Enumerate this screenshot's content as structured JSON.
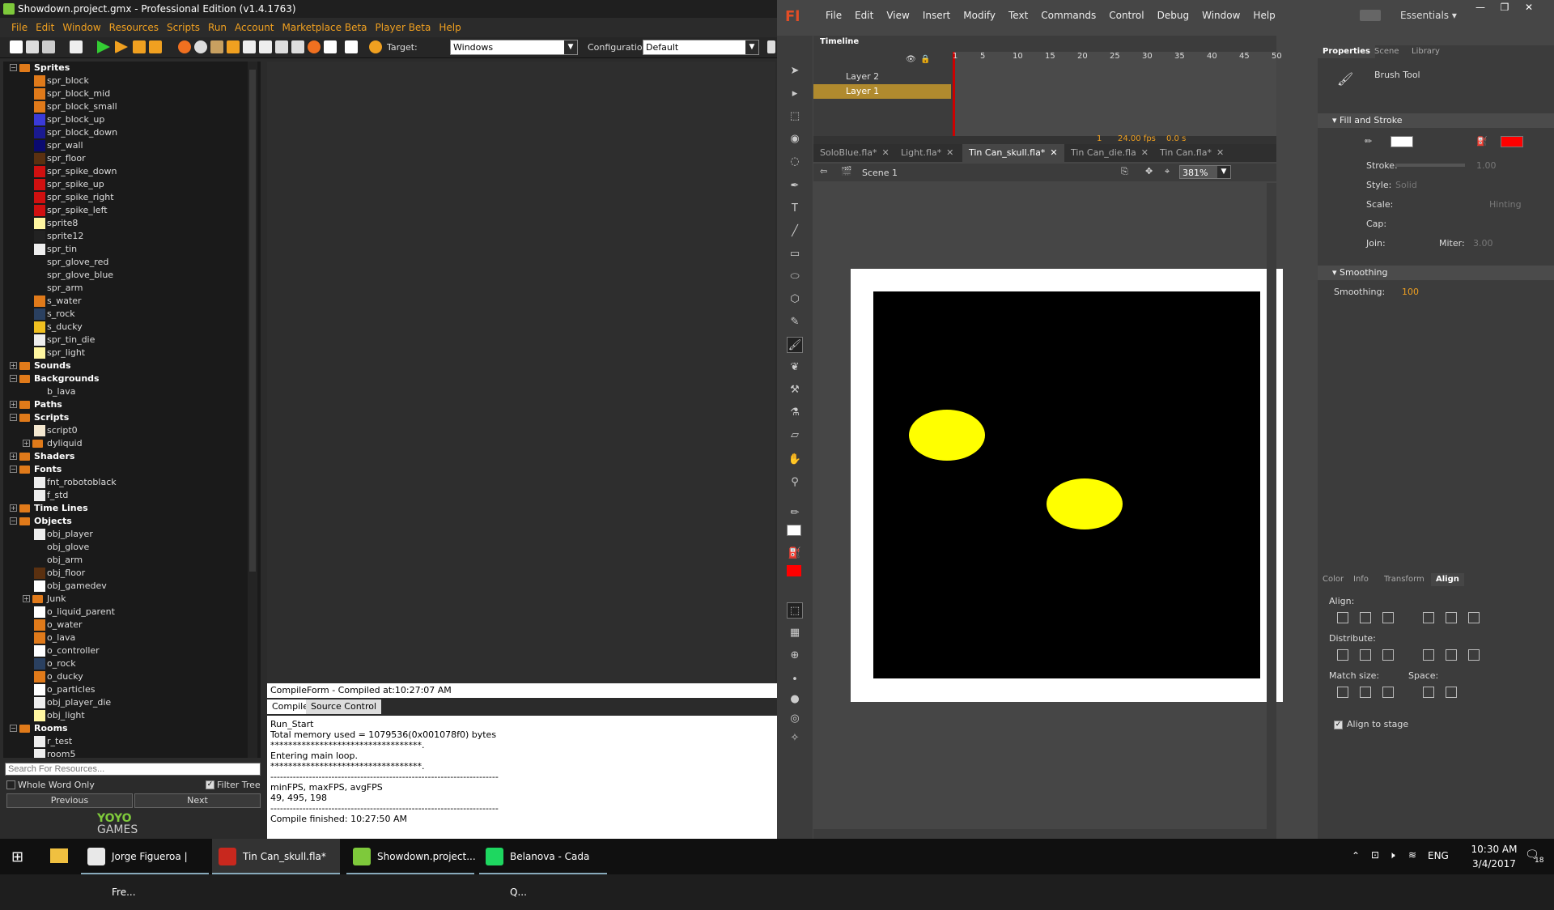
{
  "gm": {
    "title": "Showdown.project.gmx - Professional Edition (v1.4.1763)",
    "menu": [
      "File",
      "Edit",
      "Window",
      "Resources",
      "Scripts",
      "Run",
      "Account",
      "Marketplace Beta",
      "Player Beta",
      "Help"
    ],
    "target_label": "Target:",
    "target_value": "Windows",
    "config_label": "Configuration:",
    "config_value": "Default",
    "tree": [
      {
        "type": "folder",
        "label": "Sprites",
        "depth": 0,
        "expanded": true
      },
      {
        "type": "item",
        "label": "spr_block",
        "color": "#e07a1a"
      },
      {
        "type": "item",
        "label": "spr_block_mid",
        "color": "#e07a1a"
      },
      {
        "type": "item",
        "label": "spr_block_small",
        "color": "#e07a1a"
      },
      {
        "type": "item",
        "label": "spr_block_up",
        "color": "#3a3ad8"
      },
      {
        "type": "item",
        "label": "spr_block_down",
        "color": "#1a1a90"
      },
      {
        "type": "item",
        "label": "spr_wall",
        "color": "#0a0a70"
      },
      {
        "type": "item",
        "label": "spr_floor",
        "color": "#5a3010"
      },
      {
        "type": "item",
        "label": "spr_spike_down",
        "color": "#d01010"
      },
      {
        "type": "item",
        "label": "spr_spike_up",
        "color": "#d01010"
      },
      {
        "type": "item",
        "label": "spr_spike_right",
        "color": "#d01010"
      },
      {
        "type": "item",
        "label": "spr_spike_left",
        "color": "#d01010"
      },
      {
        "type": "item",
        "label": "sprite8",
        "color": "#fff6a0"
      },
      {
        "type": "item",
        "label": "sprite12",
        "color": "#222222"
      },
      {
        "type": "item",
        "label": "spr_tin",
        "color": "#eeeeee"
      },
      {
        "type": "item",
        "label": "spr_glove_red",
        "color": "#1a1a1a"
      },
      {
        "type": "item",
        "label": "spr_glove_blue",
        "color": "#1a1a1a"
      },
      {
        "type": "item",
        "label": "spr_arm",
        "color": "#1a1a1a"
      },
      {
        "type": "item",
        "label": "s_water",
        "color": "#e07a1a"
      },
      {
        "type": "item",
        "label": "s_rock",
        "color": "#2a4060"
      },
      {
        "type": "item",
        "label": "s_ducky",
        "color": "#f0c020"
      },
      {
        "type": "item",
        "label": "spr_tin_die",
        "color": "#eeeeee"
      },
      {
        "type": "item",
        "label": "spr_light",
        "color": "#fff6a0"
      },
      {
        "type": "folder",
        "label": "Sounds",
        "depth": 0,
        "expanded": false
      },
      {
        "type": "folder",
        "label": "Backgrounds",
        "depth": 0,
        "expanded": true
      },
      {
        "type": "item",
        "label": "b_lava",
        "color": ""
      },
      {
        "type": "folder",
        "label": "Paths",
        "depth": 0,
        "expanded": false
      },
      {
        "type": "folder",
        "label": "Scripts",
        "depth": 0,
        "expanded": true
      },
      {
        "type": "item",
        "label": "script0",
        "color": "#f4e8d0"
      },
      {
        "type": "subfolder",
        "label": "dyliquid",
        "color": ""
      },
      {
        "type": "folder",
        "label": "Shaders",
        "depth": 0,
        "expanded": false
      },
      {
        "type": "folder",
        "label": "Fonts",
        "depth": 0,
        "expanded": true
      },
      {
        "type": "item",
        "label": "fnt_robotoblack",
        "color": "#eeeeee"
      },
      {
        "type": "item",
        "label": "f_std",
        "color": "#eeeeee"
      },
      {
        "type": "folder",
        "label": "Time Lines",
        "depth": 0,
        "expanded": false
      },
      {
        "type": "folder",
        "label": "Objects",
        "depth": 0,
        "expanded": true
      },
      {
        "type": "item",
        "label": "obj_player",
        "color": "#eeeeee"
      },
      {
        "type": "item",
        "label": "obj_glove",
        "color": "#1a1a1a"
      },
      {
        "type": "item",
        "label": "obj_arm",
        "color": "#1a1a1a"
      },
      {
        "type": "item",
        "label": "obj_floor",
        "color": "#5a3010"
      },
      {
        "type": "item",
        "label": "obj_gamedev",
        "color": "#ffffff"
      },
      {
        "type": "subfolder",
        "label": "Junk",
        "color": ""
      },
      {
        "type": "item",
        "label": "o_liquid_parent",
        "color": "#ffffff"
      },
      {
        "type": "item",
        "label": "o_water",
        "color": "#e07a1a"
      },
      {
        "type": "item",
        "label": "o_lava",
        "color": "#e07a1a"
      },
      {
        "type": "item",
        "label": "o_controller",
        "color": "#ffffff"
      },
      {
        "type": "item",
        "label": "o_rock",
        "color": "#2a4060"
      },
      {
        "type": "item",
        "label": "o_ducky",
        "color": "#e07a1a"
      },
      {
        "type": "item",
        "label": "o_particles",
        "color": "#ffffff"
      },
      {
        "type": "item",
        "label": "obj_player_die",
        "color": "#eeeeee"
      },
      {
        "type": "item",
        "label": "obj_light",
        "color": "#fff6a0"
      },
      {
        "type": "folder",
        "label": "Rooms",
        "depth": 0,
        "expanded": true
      },
      {
        "type": "item",
        "label": "r_test",
        "color": "#eeeeee"
      },
      {
        "type": "item",
        "label": "room5",
        "color": "#eeeeee"
      }
    ],
    "search_placeholder": "Search For Resources...",
    "whole_word": "Whole Word Only",
    "filter_tree": "Filter Tree",
    "previous": "Previous",
    "next": "Next",
    "logo_line1": "YOYO",
    "logo_line2": "GAMES",
    "compile_header": "CompileForm - Compiled at:10:27:07 AM",
    "tab_compile": "Compile",
    "tab_source": "Source Control",
    "output": [
      "Run_Start",
      "Total memory used = 1079536(0x001078f0) bytes",
      "**********************************.",
      "Entering main loop.",
      "**********************************.",
      "-----------------------------------------------------------------------",
      "minFPS, maxFPS, avgFPS",
      "49, 495, 198",
      "-----------------------------------------------------------------------",
      "Compile finished: 10:27:50 AM"
    ]
  },
  "fl": {
    "logo": "Fl",
    "menu": [
      "File",
      "Edit",
      "View",
      "Insert",
      "Modify",
      "Text",
      "Commands",
      "Control",
      "Debug",
      "Window",
      "Help"
    ],
    "workspace": "Essentials",
    "timeline_tab": "Timeline",
    "layers": [
      "Layer 2",
      "Layer 1"
    ],
    "frame_numbers": [
      "1",
      "5",
      "10",
      "15",
      "20",
      "25",
      "30",
      "35",
      "40",
      "45",
      "50"
    ],
    "fps": "24.00 fps",
    "time": "0.0 s",
    "current_frame": "1",
    "doc_tabs": [
      "SoloBlue.fla*",
      "Light.fla*",
      "Tin Can_skull.fla*",
      "Tin Can_die.fla",
      "Tin Can.fla*"
    ],
    "active_doc_index": 2,
    "scene": "Scene 1",
    "zoom": "381%",
    "panel_tabs": [
      "Properties",
      "Scene",
      "Library"
    ],
    "tool_name": "Brush Tool",
    "fill_stroke": "Fill and Stroke",
    "stroke_label": "Stroke:",
    "stroke_value": "1.00",
    "style_label": "Style:",
    "style_value": "Solid",
    "scale_label": "Scale:",
    "hinting": "Hinting",
    "cap_label": "Cap:",
    "join_label": "Join:",
    "miter_label": "Miter:",
    "miter_value": "3.00",
    "smoothing_section": "Smoothing",
    "smoothing_label": "Smoothing:",
    "smoothing_value": "100",
    "align_tabs": [
      "Color",
      "Info",
      "Transform",
      "Align"
    ],
    "align_label": "Align:",
    "distribute_label": "Distribute:",
    "match_label": "Match size:",
    "space_label": "Space:",
    "align_stage": "Align to stage",
    "fill_color": "#ff0000"
  },
  "taskbar": {
    "items": [
      {
        "label": "Jorge Figueroa | Fre...",
        "color": "#e8e8e8"
      },
      {
        "label": "Tin Can_skull.fla*",
        "color": "#c8281e"
      },
      {
        "label": "Showdown.project...",
        "color": "#7ec93b"
      },
      {
        "label": "Belanova - Cada Q...",
        "color": "#1ed760"
      }
    ],
    "lang": "ENG",
    "time": "10:30 AM",
    "date": "3/4/2017",
    "notifications": "18"
  }
}
